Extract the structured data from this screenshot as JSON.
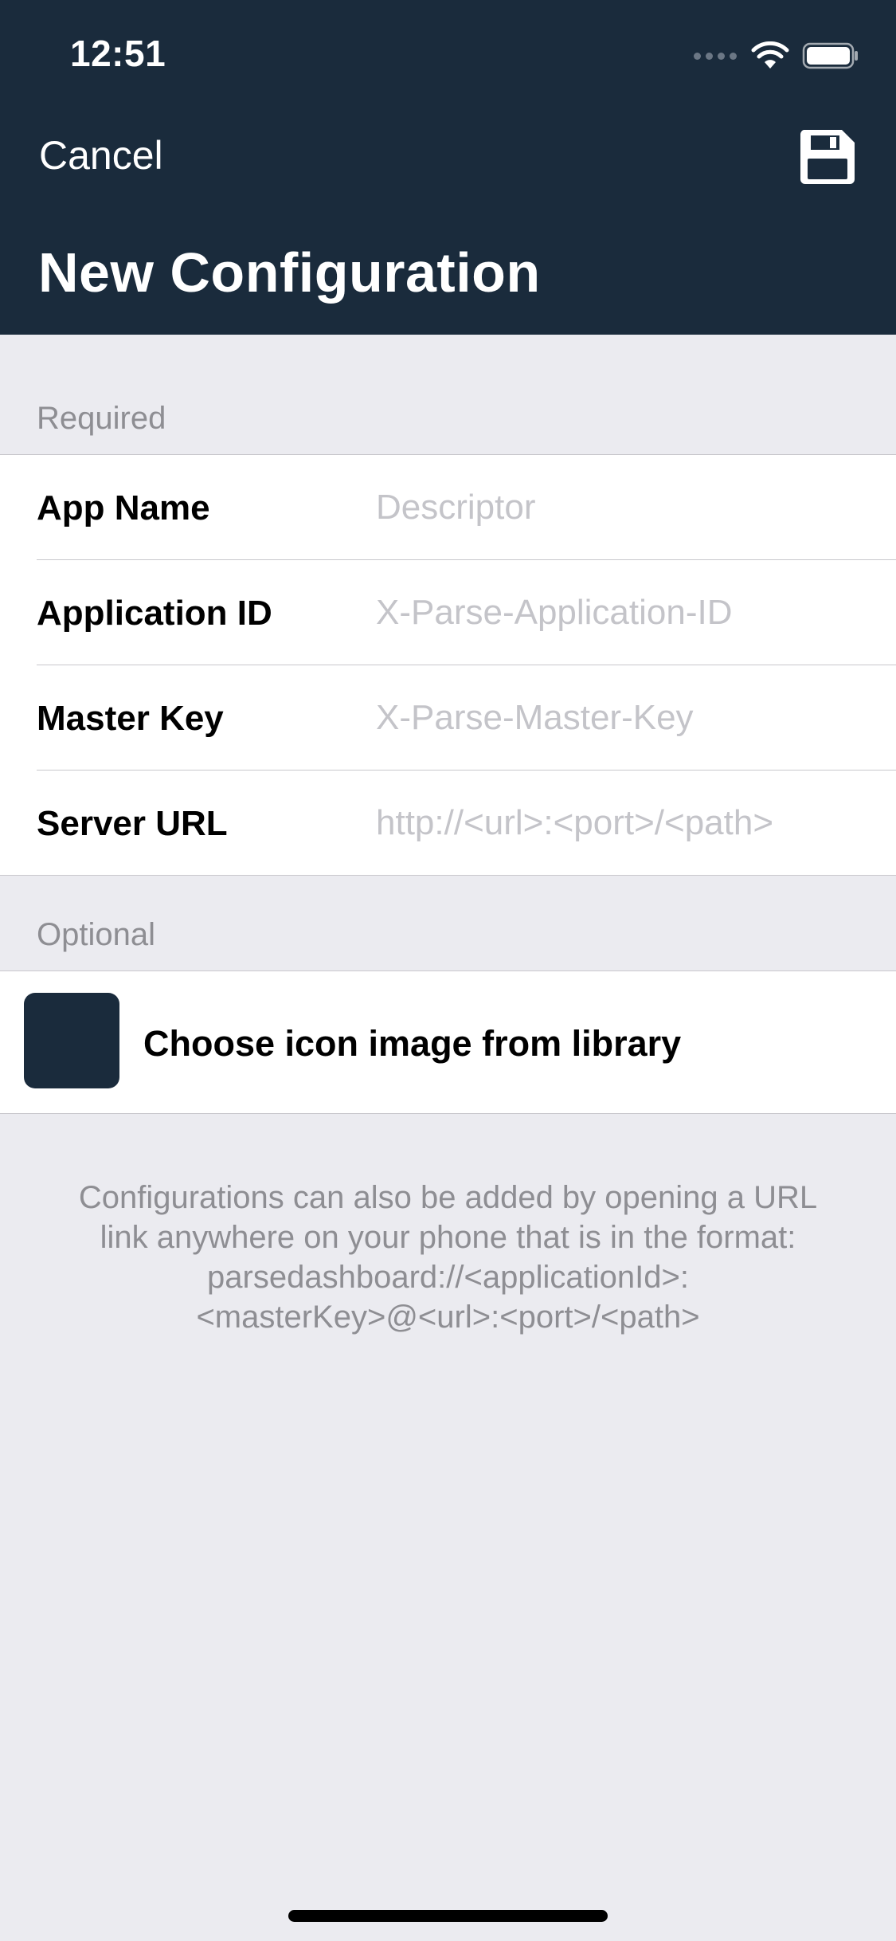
{
  "status_bar": {
    "time": "12:51",
    "icons": [
      "signal-dots-icon",
      "wifi-icon",
      "battery-icon"
    ]
  },
  "nav": {
    "cancel_label": "Cancel",
    "save_icon": "floppy-disk-icon",
    "title": "New Configuration"
  },
  "required_section": {
    "header": "Required",
    "fields": [
      {
        "label": "App Name",
        "placeholder": "Descriptor",
        "value": ""
      },
      {
        "label": "Application ID",
        "placeholder": "X-Parse-Application-ID",
        "value": ""
      },
      {
        "label": "Master Key",
        "placeholder": "X-Parse-Master-Key",
        "value": ""
      },
      {
        "label": "Server URL",
        "placeholder": "http://<url>:<port>/<path>",
        "value": ""
      }
    ]
  },
  "optional_section": {
    "header": "Optional",
    "choose_icon_label": "Choose icon image from library"
  },
  "footer_note": {
    "lines": [
      "Configurations can also be added by opening a URL",
      "link anywhere on your phone that is in the format:",
      "parsedashboard://<applicationId>:",
      "<masterKey>@<url>:<port>/<path>"
    ]
  },
  "colors": {
    "nav_background": "#1a2b3c",
    "page_background": "#ebebf0",
    "secondary_text": "#8e8e93",
    "placeholder_text": "#c4c4c9",
    "icon_swatch": "#1a2b3c"
  }
}
